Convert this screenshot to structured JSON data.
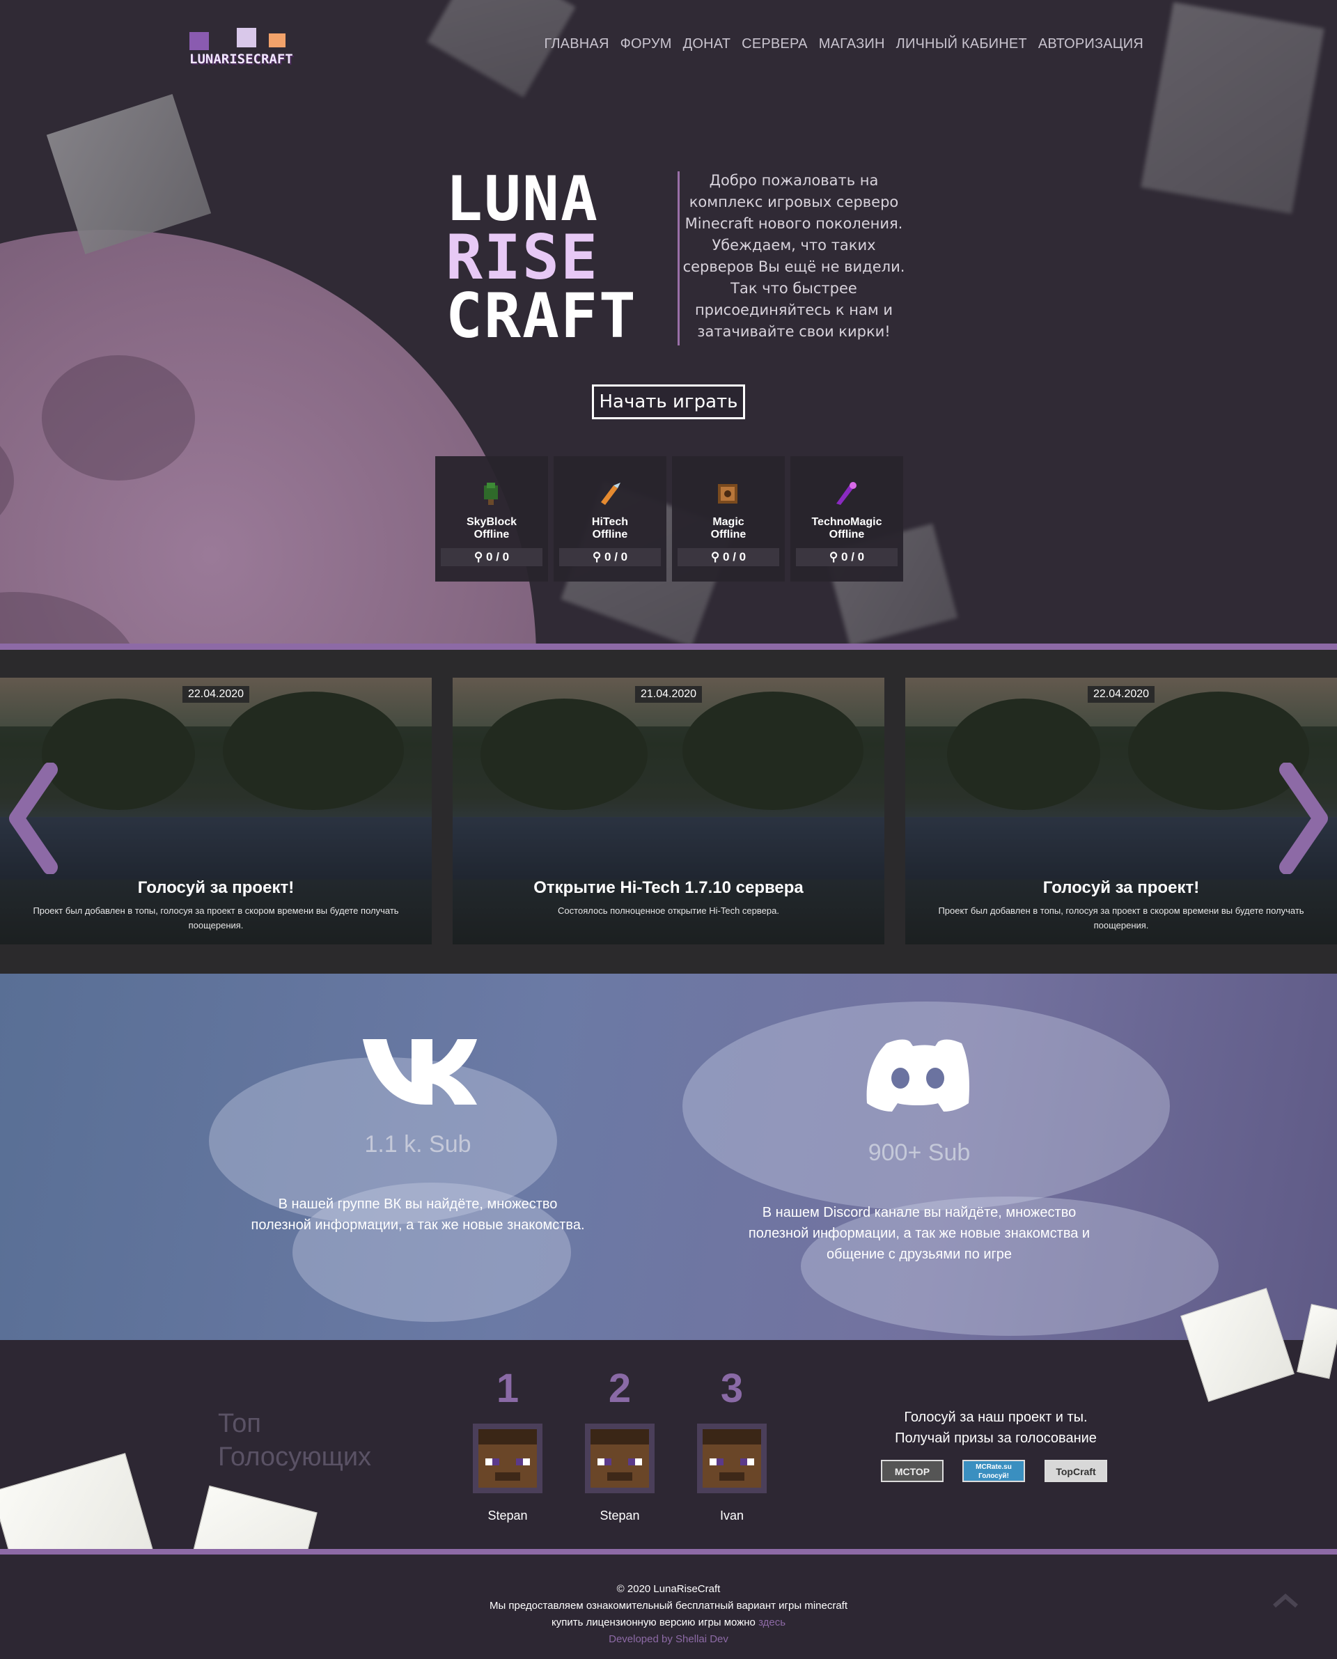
{
  "nav": [
    "ГЛАВНАЯ",
    "ФОРУМ",
    "ДОНАТ",
    "СЕРВЕРА",
    "МАГАЗИН",
    "ЛИЧНЫЙ КАБИНЕТ",
    "АВТОРИЗАЦИЯ"
  ],
  "logo_text": "LUNARISECRAFT",
  "hero": {
    "word1": "LUNA",
    "word2": "RISE",
    "word3": "CRAFT",
    "welcome": "Добро пожаловать на комплекс игровых серверо Minecraft нового поколения. Убеждаем, что таких серверов Вы ещё не видели. Так что быстрее присоединяйтесь к нам и затачивайте свои кирки!",
    "play_button": "Начать играть"
  },
  "servers": [
    {
      "name": "SkyBlock",
      "status": "Offline",
      "online": "0 / 0",
      "icon": "tree-icon"
    },
    {
      "name": "HiTech",
      "status": "Offline",
      "online": "0 / 0",
      "icon": "drill-icon"
    },
    {
      "name": "Magic",
      "status": "Offline",
      "online": "0 / 0",
      "icon": "book-icon"
    },
    {
      "name": "TechnoMagic",
      "status": "Offline",
      "online": "0 / 0",
      "icon": "wand-icon"
    }
  ],
  "news": [
    {
      "date": "22.04.2020",
      "title": "Голосуй за проект!",
      "desc": "Проект был добавлен в топы, голосуя за проект в скором времени вы будете получать поощерения."
    },
    {
      "date": "21.04.2020",
      "title": "Открытие Hi-Tech 1.7.10 сервера",
      "desc": "Состоялось полноценное открытие Hi-Tech сервера."
    },
    {
      "date": "22.04.2020",
      "title": "Голосуй за проект!",
      "desc": "Проект был добавлен в топы, голосуя за проект в скором времени вы будете получать поощерения."
    }
  ],
  "social": {
    "vk": {
      "subs": "1.1 k. Sub",
      "desc": "В нашей группе ВК вы найдёте, множество полезной информации, а так же новые знакомства."
    },
    "discord": {
      "subs": "900+ Sub",
      "desc": "В нашем Discord канале вы найдёте, множество полезной информации, а так же новые знакомства и общение с друзьями по игре"
    }
  },
  "voters": {
    "title_line1": "Топ",
    "title_line2": "Голосующих",
    "list": [
      {
        "rank": "1",
        "name": "Stepan"
      },
      {
        "rank": "2",
        "name": "Stepan"
      },
      {
        "rank": "3",
        "name": "Ivan"
      }
    ],
    "vote_text_1": "Голосуй за наш проект и ты.",
    "vote_text_2": "Получай призы за голосование",
    "tops": [
      "MCTOP",
      "MCRate.su Голосуй!",
      "TopCraft"
    ]
  },
  "footer": {
    "copyright": "© 2020 LunaRiseCraft",
    "line2": "Мы предоставляем ознакомительный бесплатный вариант игры minecraft",
    "line3": "купить лицензионную версию игры можно",
    "link": "здесь",
    "dev": "Developed by Shellai Dev"
  },
  "colors": {
    "accent": "#8d6aa6",
    "bg": "#2d2733"
  }
}
